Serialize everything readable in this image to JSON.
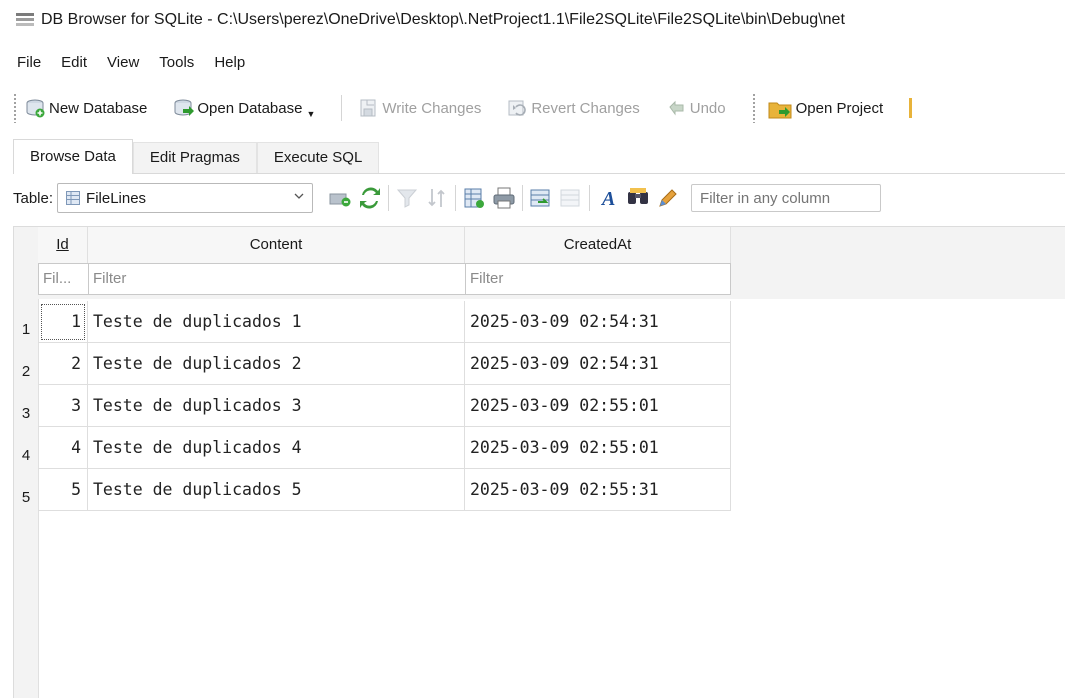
{
  "window": {
    "title": "DB Browser for SQLite - C:\\Users\\perez\\OneDrive\\Desktop\\.NetProject1.1\\File2SQLite\\File2SQLite\\bin\\Debug\\net"
  },
  "menu": [
    "File",
    "Edit",
    "View",
    "Tools",
    "Help"
  ],
  "toolbar": {
    "new_database": "New Database",
    "open_database": "Open Database",
    "write_changes": "Write Changes",
    "revert_changes": "Revert Changes",
    "undo": "Undo",
    "open_project": "Open Project"
  },
  "tabs": [
    "Browse Data",
    "Edit Pragmas",
    "Execute SQL"
  ],
  "browse": {
    "table_label": "Table:",
    "table_selected": "FileLines",
    "filter_any_placeholder": "Filter in any column"
  },
  "grid": {
    "columns": [
      "Id",
      "Content",
      "CreatedAt"
    ],
    "filters": [
      "Fil...",
      "Filter",
      "Filter"
    ],
    "row_numbers": [
      "1",
      "2",
      "3",
      "4",
      "5"
    ],
    "rows": [
      [
        "1",
        "Teste de duplicados 1",
        "2025-03-09 02:54:31"
      ],
      [
        "2",
        "Teste de duplicados 2",
        "2025-03-09 02:54:31"
      ],
      [
        "3",
        "Teste de duplicados 3",
        "2025-03-09 02:55:01"
      ],
      [
        "4",
        "Teste de duplicados 4",
        "2025-03-09 02:55:01"
      ],
      [
        "5",
        "Teste de duplicados 5",
        "2025-03-09 02:55:31"
      ]
    ]
  },
  "icons": {
    "app": "db-browser-icon",
    "toolbar": [
      "new-database-icon",
      "open-database-icon",
      "write-changes-icon",
      "revert-changes-icon",
      "undo-icon",
      "open-project-icon"
    ],
    "browse": [
      "table-icon",
      "chevron-down-icon",
      "clear-filters-icon",
      "refresh-icon",
      "filter-icon",
      "sort-icon",
      "save-table-icon",
      "print-icon",
      "insert-record-icon",
      "delete-record-icon",
      "font-icon",
      "find-icon",
      "edit-icon"
    ]
  },
  "colors": {
    "accent": "#2a8a2a",
    "folder": "#e8b33a",
    "disabled_text": "#a0a0a0",
    "header_bg": "#f3f3f3"
  }
}
